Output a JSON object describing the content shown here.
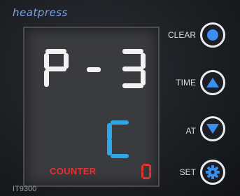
{
  "brand": "heatpress",
  "model": "IT9300",
  "display": {
    "main_text": "P-3",
    "sub_text": "C",
    "counter_label": "COUNTER",
    "counter_value": "0"
  },
  "buttons": [
    {
      "label": "CLEAR",
      "icon": "circle-icon"
    },
    {
      "label": "TIME",
      "icon": "triangle-up-icon"
    },
    {
      "label": "AT",
      "icon": "triangle-down-icon"
    },
    {
      "label": "SET",
      "icon": "gear-icon"
    }
  ],
  "colors": {
    "main_digits": "#f2f2f2",
    "sub_digit": "#2ea6e8",
    "counter": "#e53232",
    "button_accent": "#3b8ef0"
  }
}
